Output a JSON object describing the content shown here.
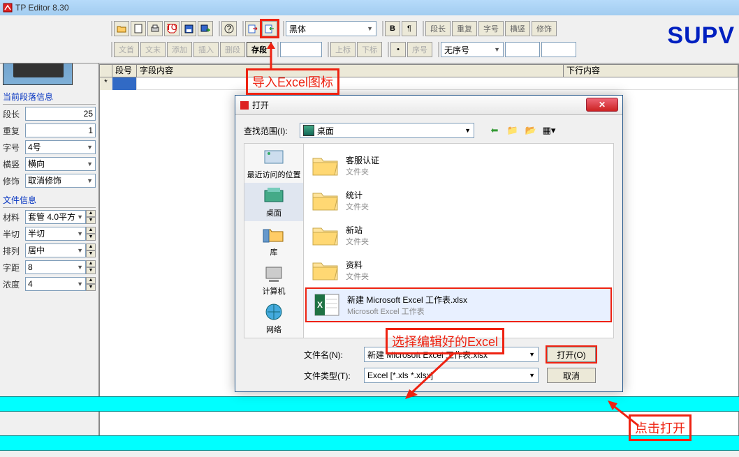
{
  "app": {
    "title": "TP Editor  8.30"
  },
  "brand": "SUPV",
  "toolbar": {
    "font": "黑体",
    "btns2a": [
      "段长",
      "重复",
      "字号",
      "横竖",
      "修饰"
    ],
    "btns3a": [
      "文首",
      "文末",
      "添加",
      "插入",
      "删段",
      "存段"
    ],
    "btns3b": [
      "上标",
      "下标"
    ],
    "seq": "序号",
    "noseq": "无序号"
  },
  "grid": {
    "h_blank": "",
    "h_seg": "段号",
    "h_content": "字段内容",
    "h_next": "下行内容",
    "star": "*"
  },
  "leftpanel": {
    "sec1_title": "当前段落信息",
    "rows1": [
      {
        "l": "段长",
        "v": "25",
        "type": "num"
      },
      {
        "l": "重复",
        "v": "1",
        "type": "num"
      },
      {
        "l": "字号",
        "v": "4号",
        "type": "sel"
      },
      {
        "l": "横竖",
        "v": "横向",
        "type": "sel"
      },
      {
        "l": "修饰",
        "v": "取消修饰",
        "type": "sel"
      }
    ],
    "sec2_title": "文件信息",
    "rows2": [
      {
        "l": "材料",
        "v": "套管 4.0平方",
        "type": "selspin"
      },
      {
        "l": "半切",
        "v": "半切",
        "type": "selspin"
      },
      {
        "l": "排列",
        "v": "居中",
        "type": "selspin"
      },
      {
        "l": "字距",
        "v": "8",
        "type": "selspin"
      },
      {
        "l": "浓度",
        "v": "4",
        "type": "selspin"
      }
    ]
  },
  "dialog": {
    "title": "打开",
    "lookin_label": "查找范围(I):",
    "lookin_val": "桌面",
    "places": [
      {
        "n": "最近访问的位置"
      },
      {
        "n": "桌面"
      },
      {
        "n": "库"
      },
      {
        "n": "计算机"
      },
      {
        "n": "网络"
      }
    ],
    "files": [
      {
        "name": "客服认证",
        "type": "文件夹",
        "kind": "folder"
      },
      {
        "name": "统计",
        "type": "文件夹",
        "kind": "folder"
      },
      {
        "name": "新站",
        "type": "文件夹",
        "kind": "folder"
      },
      {
        "name": "资料",
        "type": "文件夹",
        "kind": "folder"
      },
      {
        "name": "新建 Microsoft Excel 工作表.xlsx",
        "type": "Microsoft Excel 工作表",
        "kind": "excel",
        "sel": true
      }
    ],
    "fname_label": "文件名(N):",
    "fname_val": "新建 Microsoft Excel 工作表.xlsx",
    "ftype_label": "文件类型(T):",
    "ftype_val": "Excel  [*.xls *.xlsx]",
    "open_btn": "打开(O)",
    "cancel_btn": "取消"
  },
  "callouts": {
    "c1": "导入Excel图标",
    "c2": "选择编辑好的Excel",
    "c3": "点击打开"
  }
}
